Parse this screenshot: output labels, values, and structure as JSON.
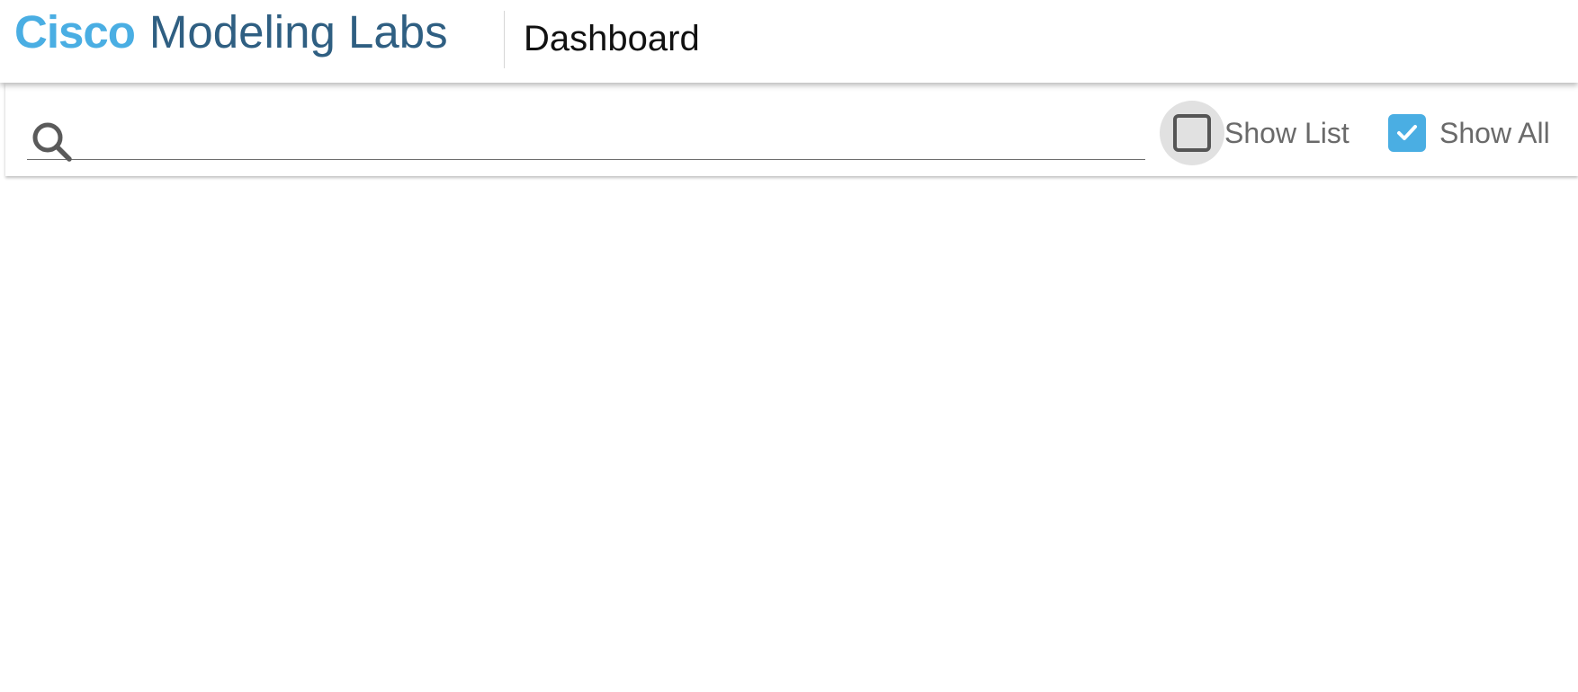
{
  "app": {
    "brand_primary": "Cisco",
    "brand_secondary": "Modeling Labs",
    "page_title": "Dashboard"
  },
  "colors": {
    "brand_blue": "#4aaee3",
    "brand_dark_blue": "#2f5f82",
    "checkbox_checked": "#4aaee3"
  },
  "toolbar": {
    "search": {
      "value": "",
      "placeholder": "",
      "icon": "search-icon"
    },
    "show_list": {
      "label": "Show List",
      "checked": false
    },
    "show_all": {
      "label": "Show All",
      "checked": true
    }
  }
}
